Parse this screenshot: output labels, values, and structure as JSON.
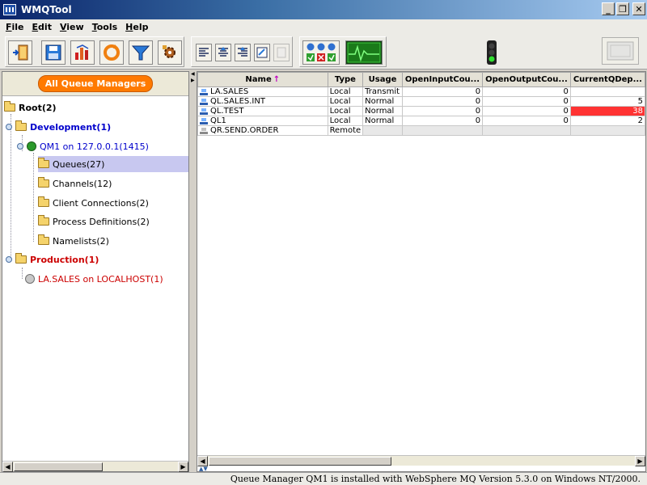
{
  "window": {
    "title": "WMQTool",
    "controls": {
      "minimize": "_",
      "restore": "❐",
      "close": "✕"
    }
  },
  "menu": [
    "File",
    "Edit",
    "View",
    "Tools",
    "Help"
  ],
  "toolbar": {
    "icons": [
      "exit-icon",
      "save-icon",
      "chart-icon",
      "refresh-icon",
      "filter-icon",
      "settings-icon",
      "align-left-icon",
      "align-center-icon",
      "align-right-icon",
      "edit-icon",
      "blank-icon",
      "status-lights-icon",
      "monitor-icon",
      "traffic-light-icon",
      "window-icon"
    ]
  },
  "tree": {
    "header_button": "All Queue Managers",
    "root": "Root(2)",
    "groups": [
      {
        "label": "Development(1)",
        "color": "#0000cc",
        "qm": {
          "label": "QM1  on 127.0.0.1(1415)",
          "children": [
            "Queues(27)",
            "Channels(12)",
            "Client Connections(2)",
            "Process Definitions(2)",
            "Namelists(2)"
          ]
        }
      },
      {
        "label": "Production(1)",
        "color": "#cc0000",
        "qm": {
          "label": "LA.SALES  on LOCALHOST(1)",
          "children": []
        }
      }
    ],
    "selected": "Queues(27)"
  },
  "table": {
    "columns": [
      "Name",
      "Type",
      "Usage",
      "OpenInputCou...",
      "OpenOutputCou...",
      "CurrentQDep..."
    ],
    "sort_indicator": "↑",
    "rows": [
      {
        "name": "LA.SALES",
        "type": "Local",
        "usage": "Transmit",
        "in": "0",
        "out": "0",
        "depth": ""
      },
      {
        "name": "QL.SALES.INT",
        "type": "Local",
        "usage": "Normal",
        "in": "0",
        "out": "0",
        "depth": "5"
      },
      {
        "name": "QL.TEST",
        "type": "Local",
        "usage": "Normal",
        "in": "0",
        "out": "0",
        "depth": "38"
      },
      {
        "name": "QL1",
        "type": "Local",
        "usage": "Normal",
        "in": "0",
        "out": "0",
        "depth": "2"
      },
      {
        "name": "QR.SEND.ORDER",
        "type": "Remote",
        "usage": "",
        "in": "",
        "out": "",
        "depth": ""
      }
    ]
  },
  "status": "Queue Manager QM1  is installed with WebSphere MQ Version 5.3.0 on Windows NT/2000.",
  "colors": {
    "alert": "#ff3333",
    "orange_button": "#ff7a00",
    "selection": "#c8c8f0"
  }
}
